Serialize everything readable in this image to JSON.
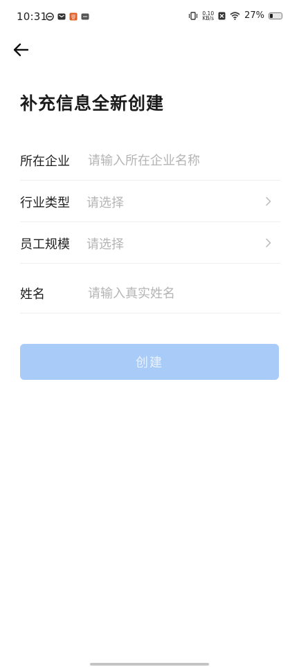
{
  "status_bar": {
    "time": "10:31",
    "net_speed_value": "0.10",
    "net_speed_unit": "KB/s",
    "battery_percent": "27%",
    "battery_level": 0.27,
    "icons": [
      "sync-icon",
      "mail-icon",
      "app-badge-icon",
      "app-icon",
      "vibrate-icon",
      "no-sim-icon",
      "wifi-icon",
      "battery-icon"
    ]
  },
  "header": {
    "back_icon": "arrow-left-icon"
  },
  "page": {
    "title": "补充信息全新创建"
  },
  "form": {
    "company": {
      "label": "所在企业",
      "placeholder": "请输入所在企业名称"
    },
    "industry": {
      "label": "行业类型",
      "placeholder": "请选择"
    },
    "staff_size": {
      "label": "员工规模",
      "placeholder": "请选择"
    },
    "name": {
      "label": "姓名",
      "placeholder": "请输入真实姓名"
    }
  },
  "actions": {
    "create_label": "创建"
  },
  "colors": {
    "button_disabled_bg": "#a9cbf7",
    "button_disabled_text": "#eaf2fd",
    "placeholder": "#b4b4b4",
    "divider": "#efefef"
  }
}
